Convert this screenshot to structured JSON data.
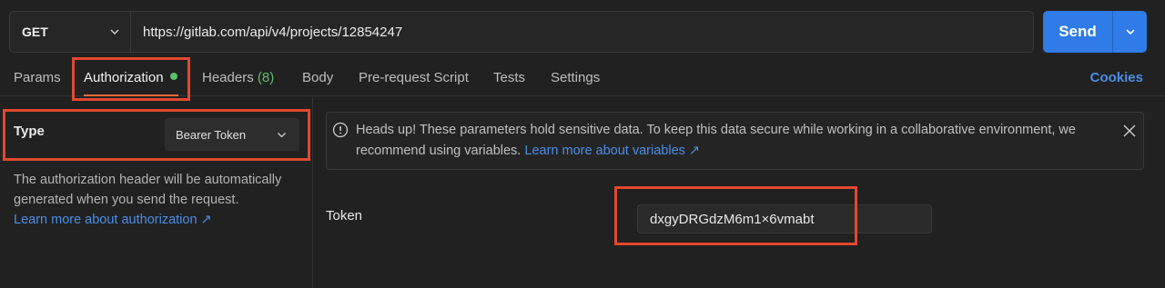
{
  "request": {
    "method": "GET",
    "url": "https://gitlab.com/api/v4/projects/12854247",
    "send_label": "Send"
  },
  "tabs": [
    {
      "label": "Params"
    },
    {
      "label": "Authorization"
    },
    {
      "label": "Headers",
      "count": "(8)"
    },
    {
      "label": "Body"
    },
    {
      "label": "Pre-request Script"
    },
    {
      "label": "Tests"
    },
    {
      "label": "Settings"
    }
  ],
  "cookies_label": "Cookies",
  "auth": {
    "type_label": "Type",
    "type_value": "Bearer Token",
    "description": "The authorization header will be automatically generated when you send the request.",
    "learn_more": "Learn more about authorization ↗"
  },
  "notice": {
    "text": "Heads up! These parameters hold sensitive data. To keep this data secure while working in a collaborative environment, we recommend using variables.",
    "link": "Learn more about variables ↗"
  },
  "token": {
    "label": "Token",
    "value": "dxgyDRGdzM6m1×6vmabt"
  },
  "colors": {
    "accent": "#2f7ce8",
    "highlight": "#e2482f",
    "active_tab": "#ef6c3a",
    "status_dot": "#59c36a"
  }
}
